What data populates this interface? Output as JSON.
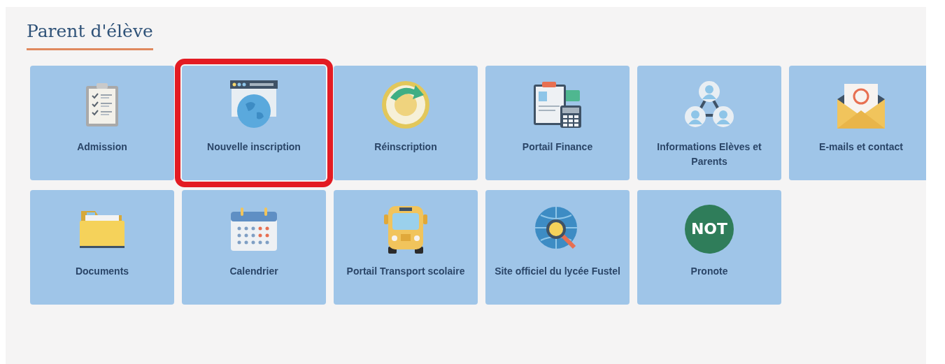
{
  "section": {
    "title": "Parent d'élève"
  },
  "tiles": [
    {
      "label": "Admission",
      "highlighted": false
    },
    {
      "label": "Nouvelle inscription",
      "highlighted": true
    },
    {
      "label": "Réinscription",
      "highlighted": false
    },
    {
      "label": "Portail Finance",
      "highlighted": false
    },
    {
      "label": "Informations Elèves et Parents",
      "highlighted": false
    },
    {
      "label": "E-mails et contact",
      "highlighted": false
    },
    {
      "label": "Documents",
      "highlighted": false
    },
    {
      "label": "Calendrier",
      "highlighted": false
    },
    {
      "label": "Portail Transport scolaire",
      "highlighted": false
    },
    {
      "label": "Site officiel du lycée Fustel",
      "highlighted": false
    },
    {
      "label": "Pronote",
      "highlighted": false,
      "badge": "NOT"
    }
  ]
}
